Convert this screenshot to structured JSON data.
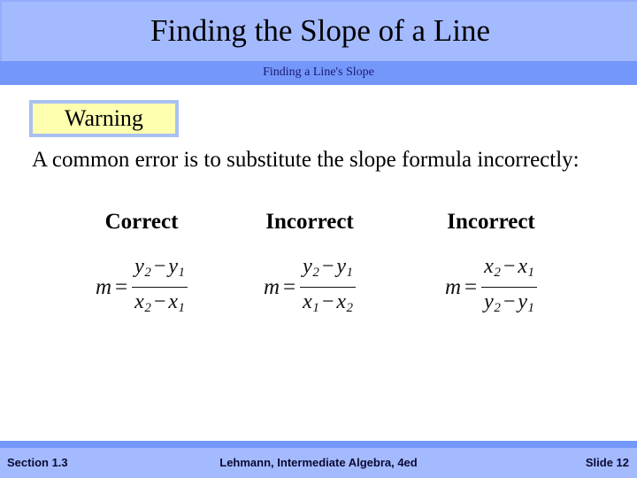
{
  "slide": {
    "title": "Finding the Slope of a Line",
    "subtitle": "Finding a Line's Slope",
    "callout": {
      "label": "Warning",
      "fill_color": "#ffffb0",
      "border_color": "#a9c0f2"
    },
    "intro_text": "A common error is to substitute the slope formula incorrectly:",
    "columns": [
      {
        "header": "Correct",
        "formula": {
          "lhs": "m",
          "eq": "=",
          "numerator": {
            "first_var": "y",
            "first_sub": "2",
            "operator": "−",
            "second_var": "y",
            "second_sub": "1"
          },
          "denominator": {
            "first_var": "x",
            "first_sub": "2",
            "operator": "−",
            "second_var": "x",
            "second_sub": "1"
          }
        }
      },
      {
        "header": "Incorrect",
        "formula": {
          "lhs": "m",
          "eq": "=",
          "numerator": {
            "first_var": "y",
            "first_sub": "2",
            "operator": "−",
            "second_var": "y",
            "second_sub": "1"
          },
          "denominator": {
            "first_var": "x",
            "first_sub": "1",
            "operator": "−",
            "second_var": "x",
            "second_sub": "2"
          }
        }
      },
      {
        "header": "Incorrect",
        "formula": {
          "lhs": "m",
          "eq": "=",
          "numerator": {
            "first_var": "x",
            "first_sub": "2",
            "operator": "−",
            "second_var": "x",
            "second_sub": "1"
          },
          "denominator": {
            "first_var": "y",
            "first_sub": "2",
            "operator": "−",
            "second_var": "y",
            "second_sub": "1"
          }
        }
      }
    ]
  },
  "footer": {
    "section": "Section 1.3",
    "source": "Lehmann, Intermediate Algebra, 4ed",
    "slide_number": "Slide 12"
  },
  "colors": {
    "title_band": "#a4baff",
    "subtitle_band": "#7497fb",
    "footer_band": "#a4baff",
    "footer_strip": "#7497fb",
    "text": "#000000",
    "subtitle_text": "#191970"
  }
}
